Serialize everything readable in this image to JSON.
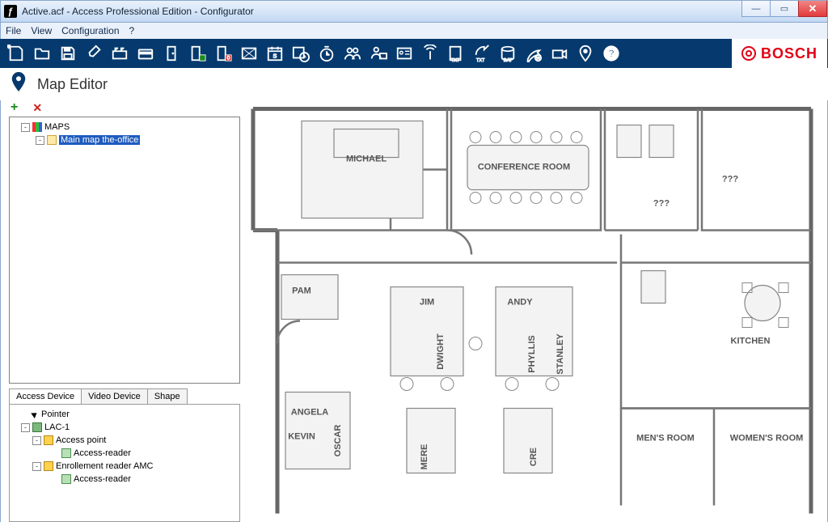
{
  "window": {
    "title": "Active.acf - Access Professional Edition - Configurator"
  },
  "menu": {
    "items": [
      "File",
      "View",
      "Configuration",
      "?"
    ]
  },
  "brand": "BOSCH",
  "page": {
    "title": "Map Editor"
  },
  "maps_tree": {
    "root_label": "MAPS",
    "child_label": "Main map the-office",
    "child_selected": true
  },
  "tabs": [
    "Access Device",
    "Video Device",
    "Shape"
  ],
  "active_tab": 0,
  "device_tree": {
    "pointer": "Pointer",
    "lac": "LAC-1",
    "nodes": [
      {
        "label": "Access point",
        "children": [
          "Access-reader"
        ]
      },
      {
        "label": "Enrollement reader AMC",
        "children": [
          "Access-reader"
        ]
      }
    ]
  },
  "floorplan_labels": {
    "michael": "MICHAEL",
    "conference": "CONFERENCE ROOM",
    "q1": "???",
    "q2": "???",
    "pam": "PAM",
    "jim": "JIM",
    "andy": "ANDY",
    "dwight": "DWIGHT",
    "phyllis": "PHYLLIS",
    "stanley": "STANLEY",
    "kitchen": "KITCHEN",
    "angela": "ANGELA",
    "kevin": "KEVIN",
    "oscar": "OSCAR",
    "mere": "MERE",
    "cre": "CRE",
    "mens": "MEN'S ROOM",
    "womens": "WOMEN'S ROOM"
  }
}
